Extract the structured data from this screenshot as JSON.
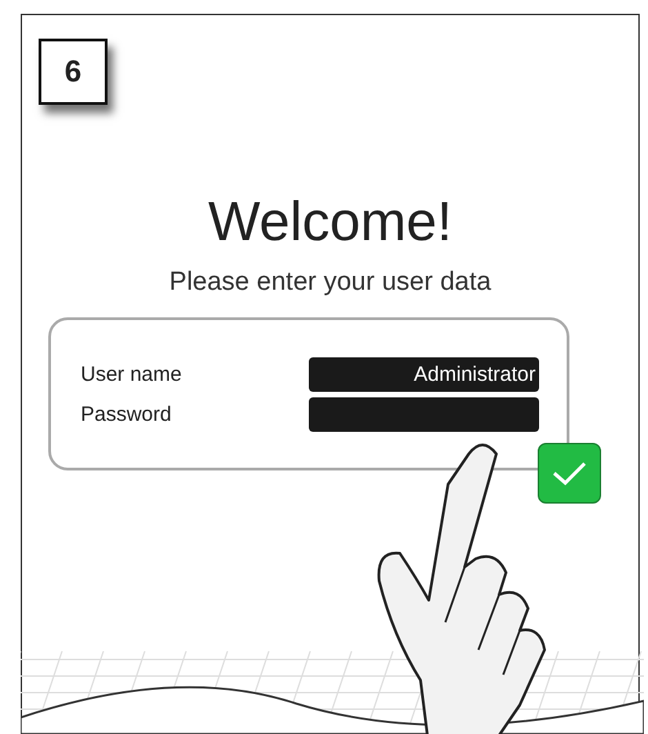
{
  "step": "6",
  "title": "Welcome!",
  "subtitle": "Please enter your user data",
  "fields": [
    {
      "label": "User name",
      "value": "Administrator"
    },
    {
      "label": "Password"
    }
  ]
}
